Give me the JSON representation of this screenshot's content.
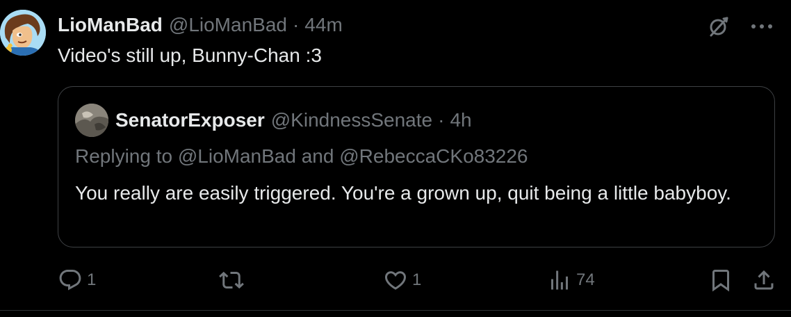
{
  "post": {
    "display_name": "LioManBad",
    "handle": "@LioManBad",
    "separator": "·",
    "time": "44m",
    "text": "Video's still up, Bunny-Chan :3",
    "avatar_icon": "cartoon-avatar"
  },
  "top_icons": [
    "grok-icon",
    "more-icon"
  ],
  "quote": {
    "display_name": "SenatorExposer",
    "handle": "@KindnessSenate",
    "separator": "·",
    "time": "4h",
    "replying_prefix": "Replying to ",
    "replying_user1": "@LioManBad",
    "replying_and": " and ",
    "replying_user2": "@RebeccaCKo83226",
    "text": "You really are easily triggered. You're a grown up, quit being a little babyboy."
  },
  "actions": {
    "reply_count": "1",
    "retweet_count": "",
    "like_count": "1",
    "views_count": "74"
  },
  "colors": {
    "background": "#000000",
    "primary_text": "#e7e9ea",
    "secondary_text": "#71767b",
    "border": "#3e4144"
  }
}
